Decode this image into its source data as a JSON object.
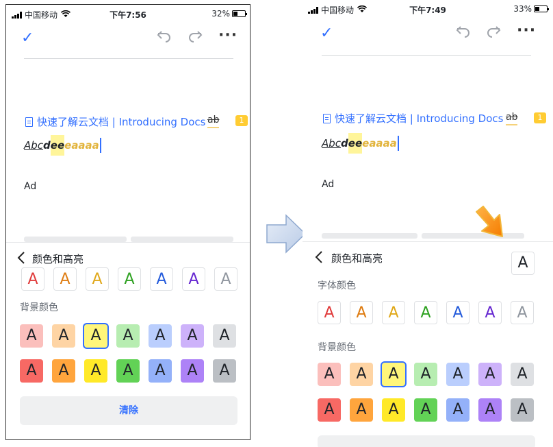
{
  "left_screen": {
    "status": {
      "carrier": "中国移动",
      "time": "下午7:56",
      "battery": "32%"
    },
    "doc": {
      "link_text": "快速了解云文档 | Introducing Docs",
      "strike_chip": "ab",
      "comment_count": "1",
      "styled": {
        "part1": "Abc",
        "part2": "d",
        "part3": "ee",
        "part4": "eaaaa"
      },
      "ad_text": "Ad"
    },
    "panel": {
      "title": "颜色和高亮",
      "bg_section": "背景颜色",
      "clear_label": "清除"
    }
  },
  "right_screen": {
    "status": {
      "carrier": "中国移动",
      "time": "下午7:49",
      "battery": "33%"
    },
    "doc": {
      "link_text": "快速了解云文档 | Introducing Docs",
      "strike_chip": "ab",
      "comment_count": "1",
      "styled": {
        "part1": "Abc",
        "part2": "d",
        "part3": "ee",
        "part4": "eaaaa"
      },
      "ad_text": "Ad"
    },
    "panel": {
      "title": "颜色和高亮",
      "font_section": "字体颜色",
      "bg_section": "背景颜色",
      "preview_glyph": "A"
    }
  },
  "swatch_glyph": "A",
  "font_colors": [
    "#e03b3b",
    "#de7c12",
    "#e0a81a",
    "#2ea121",
    "#245bdb",
    "#6425d0",
    "#8f959e"
  ],
  "bg_colors_light": [
    "#fbbfbc",
    "#fed4a4",
    "#fff67a",
    "#b7edb1",
    "#bacefd",
    "#cdb2fa",
    "#dee0e3"
  ],
  "bg_colors_dark": [
    "#f76964",
    "#ffa53d",
    "#ffe928",
    "#62d256",
    "#94b1f9",
    "#ad82f7",
    "#bbbfc4"
  ],
  "accent_color": "#3370ff",
  "icons": [
    "check-icon",
    "undo-icon",
    "redo-icon",
    "more-icon",
    "back-icon",
    "document-icon",
    "transition-arrow-icon",
    "pointer-arrow-icon"
  ]
}
